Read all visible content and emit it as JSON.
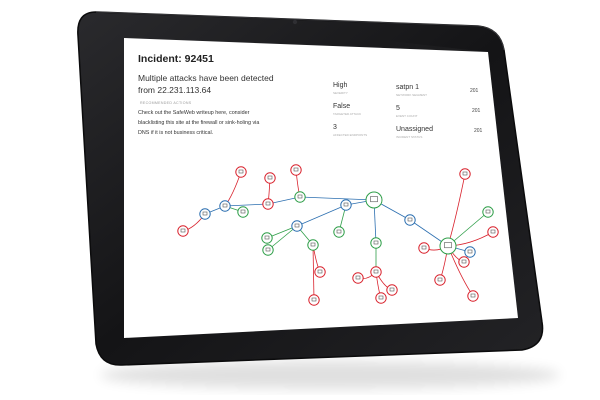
{
  "incident": {
    "title": "Incident: 92451",
    "headline_line1": "Multiple attacks have been detected",
    "headline_line2": "from 22.231.113.64",
    "recommended_label": "RECOMMENDED ACTIONS",
    "recommendation_line1": "Check out the SafeWeb writeup here, consider",
    "recommendation_line2": "blacklisting this site at the firewall or sink-holing via",
    "recommendation_line3": "DNS if it is not business critical."
  },
  "stats": {
    "severity_value": "High",
    "severity_label": "SEVERITY",
    "targeted_value": "False",
    "targeted_label": "TARGETED ATTACK",
    "endpoints_value": "3",
    "endpoints_label": "AFFECTED ENDPOINTS",
    "network_value": "satpn 1",
    "network_label": "NETWORK SEGMENT",
    "events_value": "5",
    "events_label": "EVENT COUNT",
    "assignee_value": "Unassigned",
    "assignee_label": "INCIDENT STATUS",
    "timeline": [
      "201",
      "201",
      "201"
    ]
  },
  "colors": {
    "bezel": "#1b1b1d",
    "screen": "#ffffff",
    "red": "#d9232e",
    "green": "#2e9e48",
    "blue": "#2c6fb0",
    "text": "#222222",
    "muted": "#9a9a9a"
  },
  "icons": {
    "node_icons": [
      "server-icon",
      "computer-icon",
      "document-icon",
      "globe-icon",
      "network-hub-icon"
    ]
  }
}
